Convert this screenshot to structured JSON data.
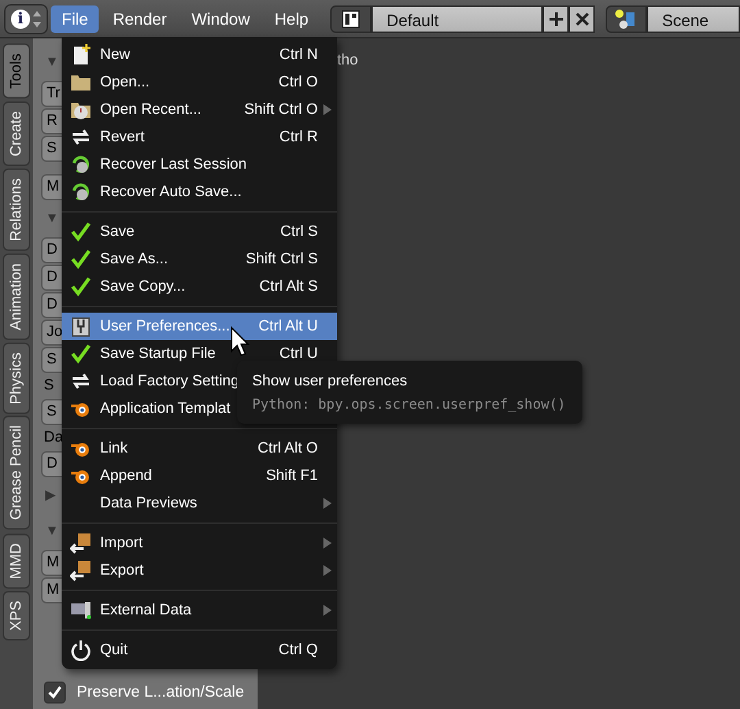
{
  "header": {
    "editor_icon": "i",
    "menus": [
      {
        "label": "File",
        "selected": true
      },
      {
        "label": "Render",
        "selected": false
      },
      {
        "label": "Window",
        "selected": false
      },
      {
        "label": "Help",
        "selected": false
      }
    ],
    "layout": "Default",
    "scene": "Scene"
  },
  "tabs": [
    {
      "label": "Tools",
      "selected": true
    },
    {
      "label": "Create",
      "selected": false
    },
    {
      "label": "Relations",
      "selected": false
    },
    {
      "label": "Animation",
      "selected": false
    },
    {
      "label": "Physics",
      "selected": false
    },
    {
      "label": "Grease Pencil",
      "selected": false
    },
    {
      "label": "MMD",
      "selected": false
    },
    {
      "label": "XPS",
      "selected": false
    }
  ],
  "panel": [
    {
      "kind": "header",
      "text": "▼"
    },
    {
      "kind": "button",
      "text": "Tr"
    },
    {
      "kind": "button",
      "text": "R"
    },
    {
      "kind": "button",
      "text": "S"
    },
    {
      "kind": "gap"
    },
    {
      "kind": "button",
      "text": "M"
    },
    {
      "kind": "header",
      "text": "▼"
    },
    {
      "kind": "button",
      "text": "D"
    },
    {
      "kind": "button",
      "text": "D"
    },
    {
      "kind": "button",
      "text": "D"
    },
    {
      "kind": "button",
      "text": "Jo"
    },
    {
      "kind": "button",
      "text": "S"
    },
    {
      "kind": "label",
      "text": "S"
    },
    {
      "kind": "button",
      "text": "S"
    },
    {
      "kind": "label",
      "text": "Da"
    },
    {
      "kind": "button",
      "text": "D"
    },
    {
      "kind": "header",
      "text": "▶"
    },
    {
      "kind": "header",
      "text": "▼"
    },
    {
      "kind": "button",
      "text": "M"
    },
    {
      "kind": "button",
      "text": "M"
    }
  ],
  "preserve": {
    "label": "Preserve L...ation/Scale",
    "checked": true
  },
  "viewport_text": "tho",
  "menu": [
    [
      {
        "kind": "new",
        "label": "New",
        "shortcut": "Ctrl N",
        "submenu": false,
        "selected": false
      },
      {
        "kind": "open",
        "label": "Open...",
        "shortcut": "Ctrl O",
        "submenu": false,
        "selected": false
      },
      {
        "kind": "recent",
        "label": "Open Recent...",
        "shortcut": "Shift Ctrl O",
        "submenu": true,
        "selected": false
      },
      {
        "kind": "revert",
        "label": "Revert",
        "shortcut": "Ctrl R",
        "submenu": false,
        "selected": false
      },
      {
        "kind": "recover",
        "label": "Recover Last Session",
        "submenu": false,
        "selected": false
      },
      {
        "kind": "recover",
        "label": "Recover Auto Save...",
        "submenu": false,
        "selected": false
      }
    ],
    [
      {
        "kind": "check",
        "label": "Save",
        "shortcut": "Ctrl S",
        "submenu": false,
        "selected": false
      },
      {
        "kind": "check",
        "label": "Save As...",
        "shortcut": "Shift Ctrl S",
        "submenu": false,
        "selected": false
      },
      {
        "kind": "check",
        "label": "Save Copy...",
        "shortcut": "Ctrl Alt S",
        "submenu": false,
        "selected": false
      }
    ],
    [
      {
        "kind": "prefs",
        "label": "User Preferences...",
        "shortcut": "Ctrl Alt U",
        "submenu": false,
        "selected": true
      },
      {
        "kind": "check",
        "label": "Save Startup File",
        "shortcut": "Ctrl U",
        "submenu": false,
        "selected": false
      },
      {
        "kind": "revert",
        "label": "Load Factory Setting",
        "submenu": false,
        "selected": false
      },
      {
        "kind": "blend",
        "label": "Application Templat",
        "submenu": false,
        "selected": false
      }
    ],
    [
      {
        "kind": "blend",
        "label": "Link",
        "shortcut": "Ctrl Alt O",
        "submenu": false,
        "selected": false
      },
      {
        "kind": "blend",
        "label": "Append",
        "shortcut": "Shift F1",
        "submenu": false,
        "selected": false
      },
      {
        "kind": "none",
        "label": "Data Previews",
        "submenu": true,
        "selected": false
      }
    ],
    [
      {
        "kind": "import",
        "label": "Import",
        "submenu": true,
        "selected": false
      },
      {
        "kind": "import",
        "label": "Export",
        "submenu": true,
        "selected": false
      }
    ],
    [
      {
        "kind": "external",
        "label": "External Data",
        "submenu": true,
        "selected": false
      }
    ],
    [
      {
        "kind": "quit",
        "label": "Quit",
        "shortcut": "Ctrl Q",
        "submenu": false,
        "selected": false
      }
    ]
  ],
  "tooltip": {
    "title": "Show user preferences",
    "python": "Python: bpy.ops.screen.userpref_show()"
  }
}
